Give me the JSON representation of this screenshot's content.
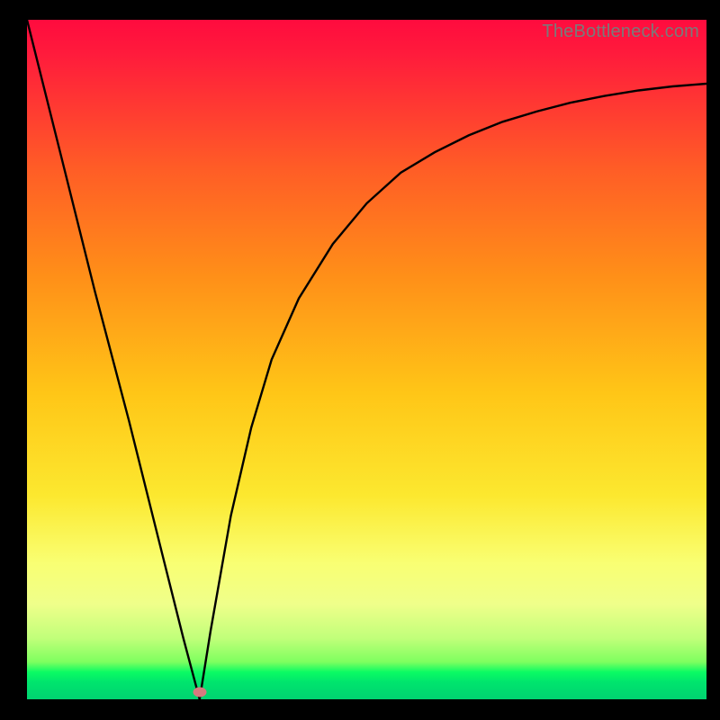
{
  "watermark": "TheBottleneck.com",
  "dot": {
    "x_pct": 25.4,
    "y_pct": 99
  },
  "chart_data": {
    "type": "line",
    "title": "",
    "xlabel": "",
    "ylabel": "",
    "xlim": [
      0,
      100
    ],
    "ylim": [
      0,
      100
    ],
    "grid": false,
    "legend": false,
    "background": "red-yellow-green vertical gradient",
    "series": [
      {
        "name": "curve",
        "x": [
          0,
          5,
          10,
          15,
          20,
          23,
          25.4,
          27,
          30,
          33,
          36,
          40,
          45,
          50,
          55,
          60,
          65,
          70,
          75,
          80,
          85,
          90,
          95,
          100
        ],
        "y": [
          100,
          80,
          60,
          41,
          21,
          9,
          0,
          10,
          27,
          40,
          50,
          59,
          67,
          73,
          77.5,
          80.5,
          83,
          85,
          86.5,
          87.8,
          88.8,
          89.6,
          90.2,
          90.6
        ],
        "note": "y is plotted inverted (0 at bottom of plot, 100 at top); curve forms sharp V at x≈25.4"
      }
    ],
    "marker": {
      "x": 25.4,
      "y": 0,
      "color": "#d77a7f"
    }
  }
}
